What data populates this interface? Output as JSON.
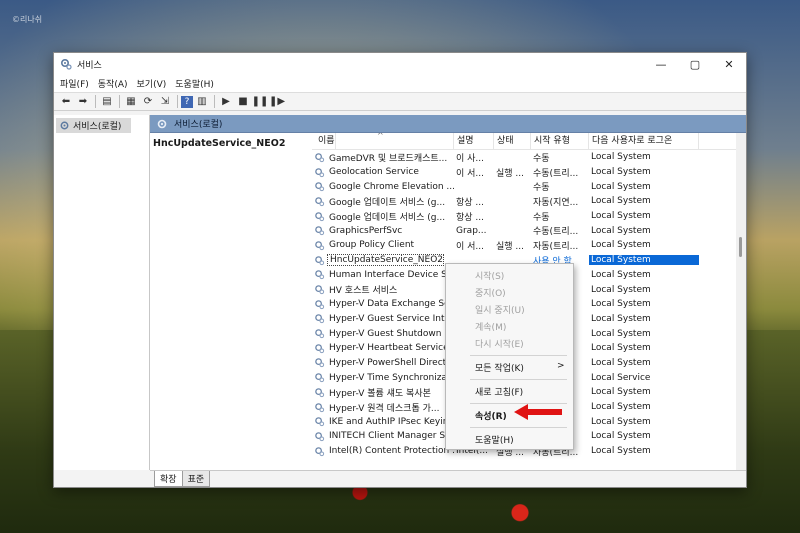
{
  "watermark": "©리나쉬",
  "window": {
    "title": "서비스",
    "controls": {
      "minimize": "—",
      "maximize": "▢",
      "close": "✕"
    }
  },
  "menu": [
    "파일(F)",
    "동작(A)",
    "보기(V)",
    "도움말(H)"
  ],
  "tree": {
    "root": "서비스(로컬)"
  },
  "right_header": "서비스(로컬)",
  "selected_service_title": "HncUpdateService_NEO2",
  "columns": {
    "name": "이름",
    "sort_glyph": "^",
    "desc": "설명",
    "status": "상태",
    "startup": "시작 유형",
    "logon": "다음 사용자로 로그온"
  },
  "services": [
    {
      "name": "GameDVR 및 브로드캐스트...",
      "desc": "이 사...",
      "status": "",
      "startup": "수동",
      "logon": "Local System"
    },
    {
      "name": "Geolocation Service",
      "desc": "이 서...",
      "status": "실행 ...",
      "startup": "수동(트리...",
      "logon": "Local System"
    },
    {
      "name": "Google Chrome Elevation ...",
      "desc": "",
      "status": "",
      "startup": "수동",
      "logon": "Local System"
    },
    {
      "name": "Google 업데이트 서비스 (g...",
      "desc": "항상 ...",
      "status": "",
      "startup": "자동(지연...",
      "logon": "Local System"
    },
    {
      "name": "Google 업데이트 서비스 (g...",
      "desc": "항상 ...",
      "status": "",
      "startup": "수동",
      "logon": "Local System"
    },
    {
      "name": "GraphicsPerfSvc",
      "desc": "Grap...",
      "status": "",
      "startup": "수동(트리...",
      "logon": "Local System"
    },
    {
      "name": "Group Policy Client",
      "desc": "이 서...",
      "status": "실행 ...",
      "startup": "자동(트리...",
      "logon": "Local System"
    },
    {
      "name": "HncUpdateService_NEO2",
      "desc": "",
      "status": "",
      "startup": "사용 안 함",
      "logon": "Local System"
    },
    {
      "name": "Human Interface Device Se",
      "desc": "",
      "status": "",
      "startup": "",
      "logon": "Local System"
    },
    {
      "name": "HV 호스트 서비스",
      "desc": "",
      "status": "",
      "startup": "",
      "logon": "Local System"
    },
    {
      "name": "Hyper-V Data Exchange Se",
      "desc": "",
      "status": "",
      "startup": "",
      "logon": "Local System"
    },
    {
      "name": "Hyper-V Guest Service Inte",
      "desc": "",
      "status": "",
      "startup": "",
      "logon": "Local System"
    },
    {
      "name": "Hyper-V Guest Shutdown ...",
      "desc": "",
      "status": "",
      "startup": "",
      "logon": "Local System"
    },
    {
      "name": "Hyper-V Heartbeat Service",
      "desc": "",
      "status": "",
      "startup": "",
      "logon": "Local System"
    },
    {
      "name": "Hyper-V PowerShell Direct...",
      "desc": "",
      "status": "",
      "startup": "",
      "logon": "Local System"
    },
    {
      "name": "Hyper-V Time Synchroniza",
      "desc": "",
      "status": "",
      "startup": "",
      "logon": "Local Service"
    },
    {
      "name": "Hyper-V 볼륨 섀도 복사본",
      "desc": "",
      "status": "",
      "startup": "",
      "logon": "Local System"
    },
    {
      "name": "Hyper-V 원격 데스크톱 가...",
      "desc": "",
      "status": "",
      "startup": "",
      "logon": "Local System"
    },
    {
      "name": "IKE and AuthIP IPsec Keyin...",
      "desc": "",
      "status": "",
      "startup": "",
      "logon": "Local System"
    },
    {
      "name": "INITECH Client Manager Se",
      "desc": "",
      "status": "",
      "startup": "",
      "logon": "Local System"
    },
    {
      "name": "Intel(R) Content Protection ...",
      "desc": "Intel(...",
      "status": "실행 ...",
      "startup": "자동(트리...",
      "logon": "Local System"
    }
  ],
  "context_menu": {
    "start": "시작(S)",
    "stop": "중지(O)",
    "pause": "일시 중지(U)",
    "resume": "계속(M)",
    "restart": "다시 시작(E)",
    "all_tasks": "모든 작업(K)",
    "submenu_arrow": ">",
    "refresh": "새로 고침(F)",
    "properties": "속성(R)",
    "help": "도움말(H)"
  },
  "tabs": [
    "확장",
    "표준"
  ],
  "colors": {
    "selection": "#0a68d6",
    "header_bar": "#7b9ac0",
    "annotation_arrow": "#e01414"
  }
}
